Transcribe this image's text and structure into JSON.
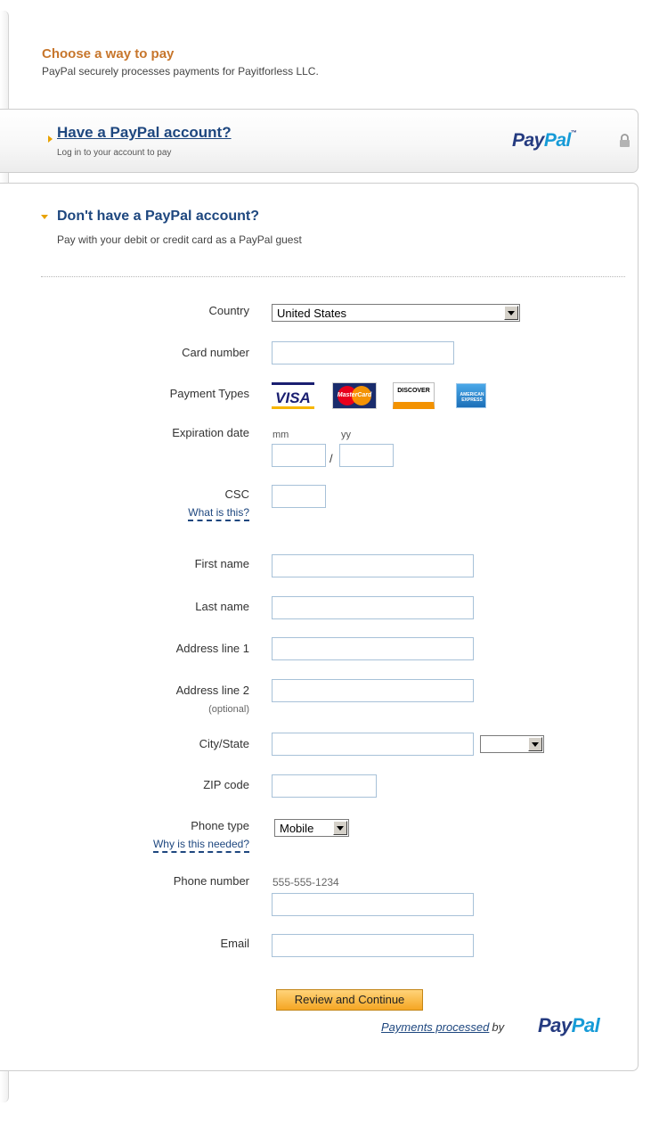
{
  "header": {
    "title": "Choose a way to pay",
    "subtitle": "PayPal securely processes payments for Payitforless LLC."
  },
  "have_account": {
    "title": "Have a PayPal account?",
    "subtitle": "Log in to your account to pay",
    "logo_part1": "Pay",
    "logo_part2": "Pal",
    "logo_tm": "™"
  },
  "guest": {
    "title": "Don't have a PayPal account?",
    "subtitle": "Pay with your debit or credit card as a PayPal guest"
  },
  "form": {
    "country_label": "Country",
    "country_value": "United States",
    "card_number_label": "Card number",
    "payment_types_label": "Payment Types",
    "cards": {
      "visa": "VISA",
      "mastercard": "MasterCard",
      "discover": "DISCOVER",
      "amex": "AMERICAN EXPRESS"
    },
    "expiration_label": "Expiration date",
    "exp_mm_hint": "mm",
    "exp_yy_hint": "yy",
    "exp_separator": "/",
    "csc_label": "CSC",
    "csc_help": "What is this?",
    "first_name_label": "First name",
    "last_name_label": "Last name",
    "address1_label": "Address line 1",
    "address2_label": "Address line 2",
    "address2_optional": "(optional)",
    "city_state_label": "City/State",
    "state_value": "",
    "zip_label": "ZIP code",
    "phone_type_label": "Phone type",
    "phone_type_help": "Why is this needed?",
    "phone_type_value": "Mobile",
    "phone_number_label": "Phone number",
    "phone_number_hint": "555-555-1234",
    "email_label": "Email",
    "submit_label": "Review and Continue"
  },
  "footer": {
    "processed_link": "Payments processed",
    "processed_by": "by",
    "logo_part1": "Pay",
    "logo_part2": "Pal"
  },
  "colors": {
    "header_orange": "#c7762c",
    "link_blue": "#1e477f",
    "paypal_dark_blue": "#253b80",
    "paypal_light_blue": "#179bd7",
    "arrow_gold": "#e8a200",
    "button_orange": "#f5a623",
    "input_border": "#a7c1d8"
  },
  "icons": {
    "collapsed_arrow": "triangle-right",
    "expanded_arrow": "triangle-down",
    "lock": "lock-icon",
    "dropdown": "chevron-down-icon"
  }
}
